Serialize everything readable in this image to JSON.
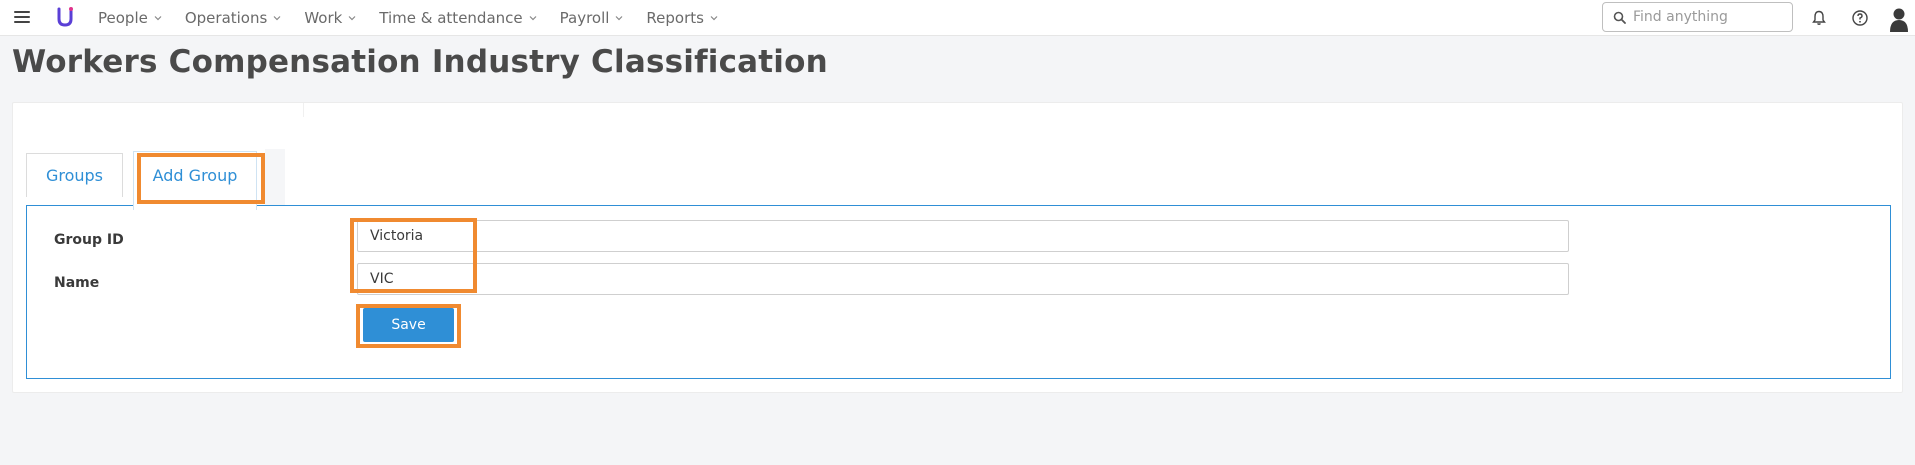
{
  "nav": {
    "items": [
      {
        "label": "People"
      },
      {
        "label": "Operations"
      },
      {
        "label": "Work"
      },
      {
        "label": "Time & attendance"
      },
      {
        "label": "Payroll"
      },
      {
        "label": "Reports"
      }
    ]
  },
  "search": {
    "placeholder": "Find anything"
  },
  "page": {
    "title": "Workers Compensation Industry Classification"
  },
  "tabs": {
    "groups": "Groups",
    "add_group": "Add Group"
  },
  "form": {
    "group_id_label": "Group ID",
    "group_id_value": "Victoria",
    "name_label": "Name",
    "name_value": "VIC",
    "save_label": "Save"
  },
  "colors": {
    "accent": "#2f8fd6",
    "highlight": "#f08a30",
    "logo": "#5a3fd6"
  }
}
